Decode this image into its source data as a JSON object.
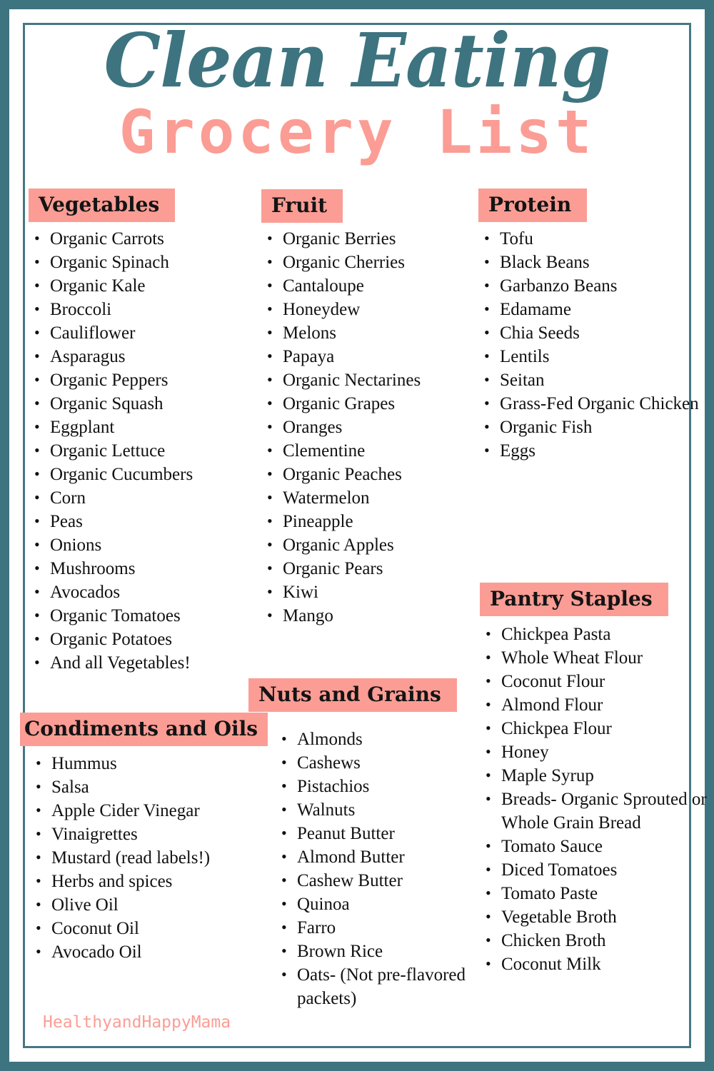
{
  "title": {
    "line1": "Clean Eating",
    "line2": "Grocery List"
  },
  "colors": {
    "teal": "#3d7480",
    "coral": "#fb9d95",
    "text": "#111111",
    "background": "#ffffff"
  },
  "sections": {
    "vegetables": {
      "heading": "Vegetables",
      "items": [
        "Organic Carrots",
        "Organic Spinach",
        "Organic Kale",
        "Broccoli",
        "Cauliflower",
        "Asparagus",
        "Organic Peppers",
        "Organic Squash",
        "Eggplant",
        "Organic Lettuce",
        "Organic Cucumbers",
        "Corn",
        "Peas",
        "Onions",
        "Mushrooms",
        "Avocados",
        "Organic Tomatoes",
        "Organic Potatoes",
        "And all Vegetables!"
      ]
    },
    "fruit": {
      "heading": "Fruit",
      "items": [
        "Organic Berries",
        "Organic Cherries",
        "Cantaloupe",
        "Honeydew",
        "Melons",
        "Papaya",
        "Organic Nectarines",
        "Organic Grapes",
        "Oranges",
        "Clementine",
        "Organic Peaches",
        "Watermelon",
        "Pineapple",
        "Organic Apples",
        "Organic Pears",
        "Kiwi",
        "Mango"
      ]
    },
    "protein": {
      "heading": "Protein",
      "items": [
        "Tofu",
        "Black Beans",
        "Garbanzo Beans",
        "Edamame",
        "Chia Seeds",
        "Lentils",
        "Seitan",
        "Grass-Fed Organic Chicken",
        "Organic Fish",
        "Eggs"
      ]
    },
    "pantry_staples": {
      "heading": "Pantry Staples",
      "items": [
        "Chickpea Pasta",
        "Whole Wheat Flour",
        "Coconut Flour",
        "Almond Flour",
        "Chickpea Flour",
        "Honey",
        "Maple Syrup",
        "Breads- Organic Sprouted or Whole Grain Bread",
        "Tomato Sauce",
        "Diced Tomatoes",
        "Tomato Paste",
        "Vegetable Broth",
        "Chicken Broth",
        "Coconut Milk"
      ]
    },
    "condiments_and_oils": {
      "heading": "Condiments and Oils",
      "items": [
        "Hummus",
        "Salsa",
        "Apple Cider Vinegar",
        "Vinaigrettes",
        "Mustard (read labels!)",
        "Herbs and spices",
        "Olive Oil",
        "Coconut Oil",
        "Avocado Oil"
      ]
    },
    "nuts_and_grains": {
      "heading": "Nuts and Grains",
      "items": [
        "Almonds",
        "Cashews",
        "Pistachios",
        "Walnuts",
        "Peanut Butter",
        "Almond Butter",
        "Cashew Butter",
        "Quinoa",
        "Farro",
        "Brown Rice",
        "Oats- (Not pre-flavored packets)"
      ]
    }
  },
  "watermark": "HealthyandHappyMama"
}
